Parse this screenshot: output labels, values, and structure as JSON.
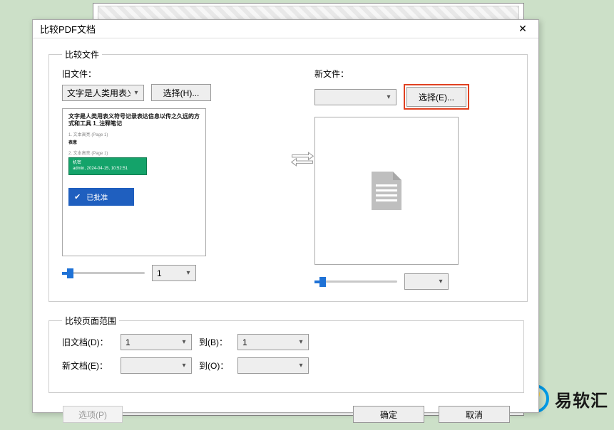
{
  "dialog": {
    "title": "比较PDF文档",
    "close_icon": "✕"
  },
  "compare_files": {
    "legend": "比较文件",
    "old": {
      "label": "旧文件：",
      "dropdown_value": "文字是人类用表义符",
      "select_btn": "选择(H)...",
      "page_value": "1",
      "preview_text": "文字是人类用表义符号记录表达信息以传之久远的方式和工具 1_注释笔记",
      "preview_sub1": "1. 文本高亮 (Page 1)",
      "preview_sub1b": "表意",
      "preview_sub2": "2. 文本高亮 (Page 1)",
      "stamp_green_line1": "机密",
      "stamp_green_line2": "admin, 2024-04-15, 10:52:51",
      "stamp_blue": "已批准"
    },
    "new": {
      "label": "新文件：",
      "dropdown_value": "",
      "select_btn": "选择(E)...",
      "page_value": ""
    }
  },
  "page_range": {
    "legend": "比较页面范围",
    "old_label": "旧文档(D)：",
    "new_label": "新文档(E)：",
    "to_label_b": "到(B)：",
    "to_label_o": "到(O)：",
    "old_from": "1",
    "old_to": "1",
    "new_from": "",
    "new_to": ""
  },
  "footer": {
    "options": "选项(P)",
    "ok": "确定",
    "cancel": "取消"
  },
  "brand": "易软汇"
}
